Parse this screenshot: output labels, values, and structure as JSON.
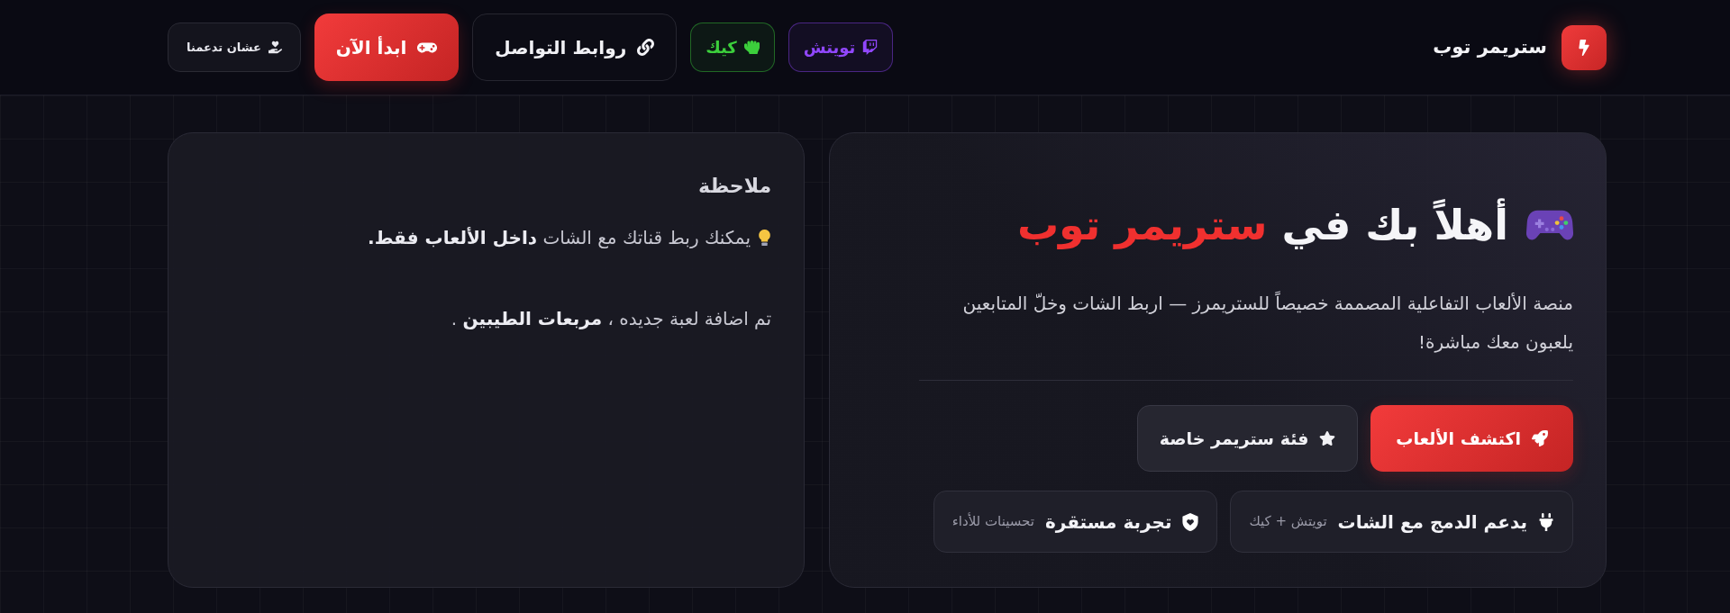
{
  "header": {
    "logo": {
      "text": "ستريمر توب"
    },
    "buttons": [
      {
        "kind": "platform",
        "label": "تويتش",
        "color": "#9147ff"
      },
      {
        "kind": "platform",
        "label": "كيك",
        "color": "#3ccf3c"
      },
      {
        "kind": "outline",
        "label": "روابط التواصل"
      },
      {
        "kind": "primary",
        "label": "ابدأ الآن"
      },
      {
        "kind": "support",
        "label": "عشان تدعمنا"
      }
    ]
  },
  "hero": {
    "heading": {
      "text": "أهلاً بك في",
      "highlight": "ستريمر توب"
    },
    "description": "منصة الألعاب التفاعلية المصممة خصيصاً للستريمرز — اربط الشات وخلّ المتابعين يلعبون معك مباشرة!",
    "actions": [
      {
        "kind": "primary",
        "label": "اكتشف الألعاب"
      },
      {
        "kind": "secondary",
        "label": "فئة ستريمر خاصة"
      }
    ],
    "features": [
      {
        "title": "يدعم الدمج مع الشات",
        "subtitle": "تويتش + كيك"
      },
      {
        "title": "تجربة مستقرة",
        "subtitle": "تحسينات للأداء"
      }
    ]
  },
  "note": {
    "title": "ملاحظة",
    "lines": [
      {
        "kind": "tip",
        "text": "يمكنك ربط قناتك مع الشات **داخل الألعاب فقط.**"
      },
      {
        "kind": "plain",
        "text": "تم اضافة لعبة جديده ، **مربعات الطيبين** ."
      }
    ]
  }
}
